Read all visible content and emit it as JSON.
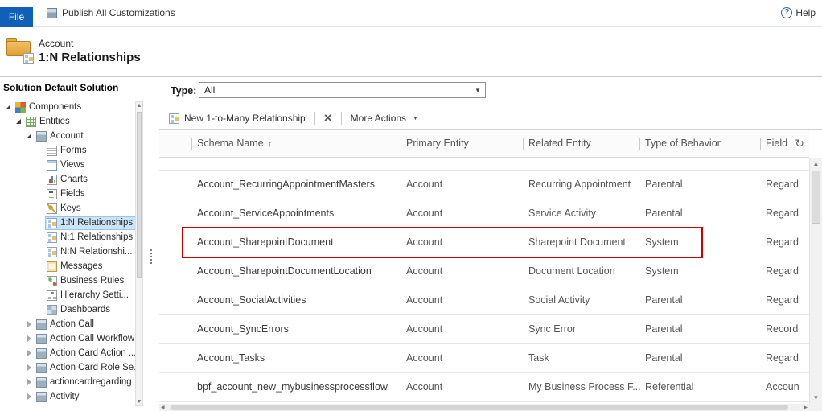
{
  "topbar": {
    "file_label": "File",
    "publish_label": "Publish All Customizations",
    "help_label": "Help"
  },
  "header": {
    "entity_name": "Account",
    "page_title": "1:N Relationships"
  },
  "sidebar": {
    "title": "Solution Default Solution",
    "items": [
      {
        "label": "Components",
        "level": 0,
        "state": "expanded",
        "icon": "components-icon",
        "selected": false
      },
      {
        "label": "Entities",
        "level": 1,
        "state": "expanded",
        "icon": "entities-icon",
        "selected": false
      },
      {
        "label": "Account",
        "level": 2,
        "state": "expanded",
        "icon": "entity-icon",
        "selected": false
      },
      {
        "label": "Forms",
        "level": 3,
        "state": "leaf",
        "icon": "forms-icon",
        "selected": false
      },
      {
        "label": "Views",
        "level": 3,
        "state": "leaf",
        "icon": "views-icon",
        "selected": false
      },
      {
        "label": "Charts",
        "level": 3,
        "state": "leaf",
        "icon": "charts-icon",
        "selected": false
      },
      {
        "label": "Fields",
        "level": 3,
        "state": "leaf",
        "icon": "fields-icon",
        "selected": false
      },
      {
        "label": "Keys",
        "level": 3,
        "state": "leaf",
        "icon": "keys-icon",
        "selected": false
      },
      {
        "label": "1:N Relationships",
        "level": 3,
        "state": "leaf",
        "icon": "one-to-many-icon",
        "selected": true
      },
      {
        "label": "N:1 Relationships",
        "level": 3,
        "state": "leaf",
        "icon": "many-to-one-icon",
        "selected": false
      },
      {
        "label": "N:N Relationshi...",
        "level": 3,
        "state": "leaf",
        "icon": "many-to-many-icon",
        "selected": false
      },
      {
        "label": "Messages",
        "level": 3,
        "state": "leaf",
        "icon": "messages-icon",
        "selected": false
      },
      {
        "label": "Business Rules",
        "level": 3,
        "state": "leaf",
        "icon": "business-rules-icon",
        "selected": false
      },
      {
        "label": "Hierarchy Setti...",
        "level": 3,
        "state": "leaf",
        "icon": "hierarchy-icon",
        "selected": false
      },
      {
        "label": "Dashboards",
        "level": 3,
        "state": "leaf",
        "icon": "dashboards-icon",
        "selected": false
      },
      {
        "label": "Action Call",
        "level": 2,
        "state": "collapsed",
        "icon": "entity-icon",
        "selected": false
      },
      {
        "label": "Action Call Workflow",
        "level": 2,
        "state": "collapsed",
        "icon": "entity-icon",
        "selected": false
      },
      {
        "label": "Action Card Action ...",
        "level": 2,
        "state": "collapsed",
        "icon": "entity-icon",
        "selected": false
      },
      {
        "label": "Action Card Role Se...",
        "level": 2,
        "state": "collapsed",
        "icon": "entity-icon",
        "selected": false
      },
      {
        "label": "actioncardregarding",
        "level": 2,
        "state": "collapsed",
        "icon": "entity-icon",
        "selected": false
      },
      {
        "label": "Activity",
        "level": 2,
        "state": "collapsed",
        "icon": "entity-icon",
        "selected": false
      }
    ]
  },
  "main": {
    "type_label": "Type:",
    "type_value": "All",
    "toolbar": {
      "new_label": "New 1-to-Many Relationship",
      "more_actions_label": "More Actions"
    },
    "grid": {
      "columns": [
        "Schema Name",
        "Primary Entity",
        "Related Entity",
        "Type of Behavior",
        "Field"
      ],
      "sort_column": "Schema Name",
      "rows": [
        {
          "schema": "Account_RecurringAppointmentMasters",
          "primary": "Account",
          "related": "Recurring Appointment",
          "behavior": "Parental",
          "field": "Regard",
          "highlight": false
        },
        {
          "schema": "Account_ServiceAppointments",
          "primary": "Account",
          "related": "Service Activity",
          "behavior": "Parental",
          "field": "Regard",
          "highlight": false
        },
        {
          "schema": "Account_SharepointDocument",
          "primary": "Account",
          "related": "Sharepoint Document",
          "behavior": "System",
          "field": "Regard",
          "highlight": true
        },
        {
          "schema": "Account_SharepointDocumentLocation",
          "primary": "Account",
          "related": "Document Location",
          "behavior": "System",
          "field": "Regard",
          "highlight": false
        },
        {
          "schema": "Account_SocialActivities",
          "primary": "Account",
          "related": "Social Activity",
          "behavior": "Parental",
          "field": "Regard",
          "highlight": false
        },
        {
          "schema": "Account_SyncErrors",
          "primary": "Account",
          "related": "Sync Error",
          "behavior": "Parental",
          "field": "Record",
          "highlight": false
        },
        {
          "schema": "Account_Tasks",
          "primary": "Account",
          "related": "Task",
          "behavior": "Parental",
          "field": "Regard",
          "highlight": false
        },
        {
          "schema": "bpf_account_new_mybusinessprocessflow",
          "primary": "Account",
          "related": "My Business Process F...",
          "behavior": "Referential",
          "field": "Accoun",
          "highlight": false
        }
      ]
    }
  },
  "icons": {
    "delete_glyph": "×",
    "dropdown_arrow": "▼",
    "menu_caret": "▼",
    "sort_asc": "↑",
    "refresh_glyph": "↻",
    "scroll_up": "▲",
    "scroll_down": "▼",
    "scroll_left": "◀",
    "scroll_right": "▶",
    "help_glyph": "?"
  },
  "colors": {
    "accent_blue": "#1160B7",
    "highlight_red": "#CC0000",
    "tree_selected_bg": "#CBE3F6"
  }
}
